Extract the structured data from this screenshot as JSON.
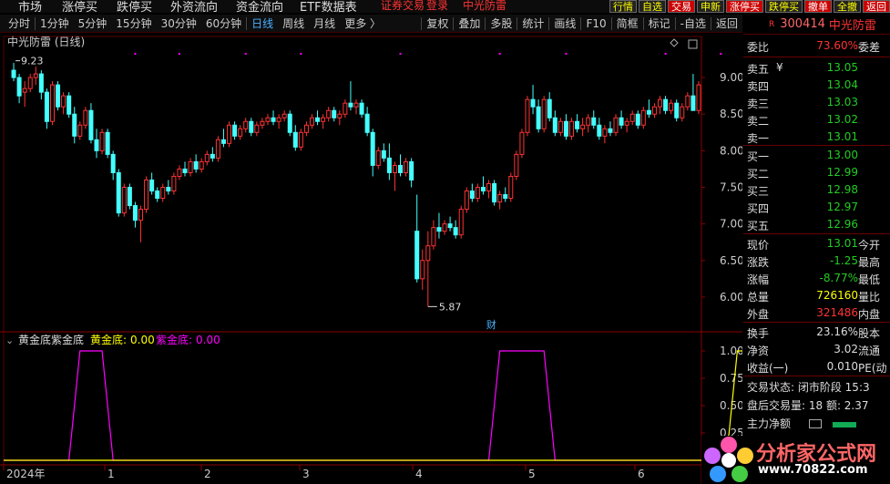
{
  "menu": {
    "items": [
      "市场",
      "涨停买",
      "跌停买",
      "外资流向",
      "资金流向",
      "ETF数据表"
    ],
    "center_left": "证券交易",
    "center_mid": "登录",
    "center_right": "中光防雷"
  },
  "quick_buttons": [
    "行情",
    "自选",
    "交易",
    "申新",
    "涨停买",
    "跌停买",
    "撤单",
    "全撤",
    "返回"
  ],
  "periods": [
    "分时",
    "1分钟",
    "5分钟",
    "15分钟",
    "30分钟",
    "60分钟",
    "日线",
    "周线",
    "月线",
    "更多 〉"
  ],
  "active_period": "日线",
  "tools": [
    "复权",
    "叠加",
    "多股",
    "统计",
    "画线",
    "F10",
    "简框",
    "标记",
    "-自选",
    "返回"
  ],
  "stock": {
    "r": "R",
    "code": "300414",
    "name": "中光防雷"
  },
  "chart_title": "中光防雷 (日线)",
  "indicator": {
    "name": "黄金底紫金底",
    "gold_label": "黄金底:",
    "gold_value": "0.00",
    "purple_label": "紫金底:",
    "purple_value": "0.00"
  },
  "annotations": {
    "high": "9.23",
    "low": "5.87",
    "fin": "财"
  },
  "x_labels": [
    "2024年",
    "1",
    "2",
    "3",
    "4",
    "5",
    "6"
  ],
  "panel": {
    "weibi": {
      "label": "委比",
      "value": "73.60%",
      "right": "委差"
    },
    "asks": [
      {
        "label": "卖五",
        "mark": "¥",
        "price": "13.05"
      },
      {
        "label": "卖四",
        "price": "13.04"
      },
      {
        "label": "卖三",
        "price": "13.03"
      },
      {
        "label": "卖二",
        "price": "13.02"
      },
      {
        "label": "卖一",
        "price": "13.01"
      }
    ],
    "bids": [
      {
        "label": "买一",
        "price": "13.00"
      },
      {
        "label": "买二",
        "price": "12.99"
      },
      {
        "label": "买三",
        "price": "12.98"
      },
      {
        "label": "买四",
        "price": "12.97"
      },
      {
        "label": "买五",
        "price": "12.96"
      }
    ],
    "stats": [
      {
        "label": "现价",
        "value": "13.01",
        "right": "今开",
        "color": "gr"
      },
      {
        "label": "涨跌",
        "value": "-1.25",
        "right": "最高",
        "color": "gr"
      },
      {
        "label": "涨幅",
        "value": "-8.77%",
        "right": "最低",
        "color": "gr"
      },
      {
        "label": "总量",
        "value": "726160",
        "right": "量比",
        "color": "yl"
      },
      {
        "label": "外盘",
        "value": "321486",
        "right": "内盘",
        "color": "rd"
      }
    ],
    "stats2": [
      {
        "label": "换手",
        "value": "23.16%",
        "right": "股本"
      },
      {
        "label": "净资",
        "value": "3.02",
        "right": "流通"
      },
      {
        "label": "收益(一)",
        "value": "0.010",
        "right": "PE(动"
      }
    ],
    "trade_status": "交易状态: 闭市阶段 15:3",
    "after_vol": "盘后交易量: 18  额: 2.37",
    "main_flow": "主力净额"
  },
  "logo": {
    "text": "分析家公式网",
    "url": "www.70822.com"
  },
  "chart_data": {
    "type": "candlestick",
    "title": "中光防雷 (日线)",
    "ylim": [
      5.7,
      9.35
    ],
    "y_ticks": [
      9.0,
      8.5,
      8.0,
      7.5,
      7.0,
      6.5,
      6.0
    ],
    "high_annotation": 9.23,
    "low_annotation": 5.87,
    "candles": [
      [
        9.1,
        9.2,
        8.95,
        9.0
      ],
      [
        9.0,
        9.05,
        8.65,
        8.75
      ],
      [
        8.8,
        8.95,
        8.6,
        8.85
      ],
      [
        8.85,
        9.05,
        8.8,
        9.0
      ],
      [
        9.0,
        9.15,
        8.9,
        9.05
      ],
      [
        9.05,
        9.1,
        8.7,
        8.8
      ],
      [
        8.8,
        8.85,
        8.3,
        8.4
      ],
      [
        8.4,
        8.95,
        8.35,
        8.9
      ],
      [
        8.9,
        8.95,
        8.55,
        8.6
      ],
      [
        8.6,
        8.8,
        8.5,
        8.75
      ],
      [
        8.75,
        8.8,
        8.45,
        8.5
      ],
      [
        8.5,
        8.6,
        8.1,
        8.2
      ],
      [
        8.2,
        8.4,
        8.15,
        8.35
      ],
      [
        8.35,
        8.6,
        8.3,
        8.55
      ],
      [
        8.55,
        8.65,
        8.1,
        8.15
      ],
      [
        8.15,
        8.3,
        7.9,
        8.0
      ],
      [
        8.0,
        8.3,
        7.95,
        8.25
      ],
      [
        8.25,
        8.3,
        7.9,
        7.95
      ],
      [
        7.95,
        8.0,
        7.6,
        7.7
      ],
      [
        7.7,
        7.75,
        7.1,
        7.15
      ],
      [
        7.15,
        7.55,
        7.1,
        7.5
      ],
      [
        7.5,
        7.55,
        7.2,
        7.25
      ],
      [
        7.25,
        7.3,
        6.95,
        7.05
      ],
      [
        7.05,
        7.25,
        6.75,
        7.2
      ],
      [
        7.2,
        7.65,
        7.15,
        7.6
      ],
      [
        7.6,
        7.7,
        7.4,
        7.45
      ],
      [
        7.45,
        7.5,
        7.3,
        7.35
      ],
      [
        7.35,
        7.55,
        7.3,
        7.5
      ],
      [
        7.5,
        7.6,
        7.4,
        7.45
      ],
      [
        7.45,
        7.7,
        7.4,
        7.65
      ],
      [
        7.65,
        7.8,
        7.6,
        7.75
      ],
      [
        7.75,
        7.85,
        7.65,
        7.7
      ],
      [
        7.7,
        7.9,
        7.65,
        7.85
      ],
      [
        7.85,
        7.95,
        7.7,
        7.75
      ],
      [
        7.75,
        7.9,
        7.7,
        7.85
      ],
      [
        7.85,
        8.0,
        7.8,
        7.95
      ],
      [
        7.95,
        8.05,
        7.85,
        7.9
      ],
      [
        7.9,
        8.2,
        7.85,
        8.15
      ],
      [
        8.15,
        8.3,
        8.05,
        8.1
      ],
      [
        8.1,
        8.4,
        8.05,
        8.35
      ],
      [
        8.35,
        8.4,
        8.15,
        8.2
      ],
      [
        8.2,
        8.35,
        8.15,
        8.3
      ],
      [
        8.3,
        8.45,
        8.25,
        8.4
      ],
      [
        8.4,
        8.45,
        8.2,
        8.25
      ],
      [
        8.25,
        8.4,
        8.2,
        8.35
      ],
      [
        8.35,
        8.45,
        8.3,
        8.4
      ],
      [
        8.4,
        8.5,
        8.35,
        8.45
      ],
      [
        8.45,
        8.55,
        8.35,
        8.4
      ],
      [
        8.4,
        8.5,
        8.3,
        8.45
      ],
      [
        8.45,
        8.55,
        8.4,
        8.5
      ],
      [
        8.5,
        8.55,
        8.2,
        8.25
      ],
      [
        8.25,
        8.35,
        8.0,
        8.05
      ],
      [
        8.05,
        8.3,
        8.0,
        8.25
      ],
      [
        8.25,
        8.4,
        8.2,
        8.35
      ],
      [
        8.35,
        8.5,
        8.3,
        8.45
      ],
      [
        8.45,
        8.55,
        8.35,
        8.4
      ],
      [
        8.4,
        8.5,
        8.3,
        8.45
      ],
      [
        8.45,
        8.6,
        8.4,
        8.55
      ],
      [
        8.55,
        8.6,
        8.4,
        8.45
      ],
      [
        8.45,
        8.55,
        8.35,
        8.5
      ],
      [
        8.5,
        8.7,
        8.45,
        8.65
      ],
      [
        8.65,
        8.95,
        8.55,
        8.6
      ],
      [
        8.6,
        8.7,
        8.5,
        8.65
      ],
      [
        8.65,
        8.7,
        8.45,
        8.5
      ],
      [
        8.5,
        8.6,
        8.2,
        8.25
      ],
      [
        8.25,
        8.3,
        7.65,
        7.8
      ],
      [
        7.8,
        8.05,
        7.75,
        8.0
      ],
      [
        8.0,
        8.1,
        7.85,
        7.9
      ],
      [
        7.9,
        8.1,
        7.6,
        7.7
      ],
      [
        7.7,
        7.85,
        7.45,
        7.8
      ],
      [
        7.8,
        7.95,
        7.65,
        7.7
      ],
      [
        7.7,
        7.9,
        7.65,
        7.85
      ],
      [
        7.85,
        7.9,
        7.5,
        7.6
      ],
      [
        6.9,
        7.4,
        6.2,
        6.25
      ],
      [
        6.25,
        6.65,
        6.1,
        6.5
      ],
      [
        6.5,
        6.9,
        5.87,
        6.7
      ],
      [
        6.7,
        7.05,
        6.65,
        6.95
      ],
      [
        6.95,
        7.15,
        6.8,
        6.9
      ],
      [
        6.9,
        7.05,
        6.85,
        7.0
      ],
      [
        7.0,
        7.1,
        6.9,
        6.95
      ],
      [
        6.95,
        7.05,
        6.8,
        6.85
      ],
      [
        6.85,
        7.25,
        6.8,
        7.2
      ],
      [
        7.2,
        7.5,
        7.15,
        7.45
      ],
      [
        7.45,
        7.55,
        7.3,
        7.35
      ],
      [
        7.35,
        7.55,
        7.3,
        7.5
      ],
      [
        7.5,
        7.65,
        7.4,
        7.45
      ],
      [
        7.45,
        7.6,
        7.35,
        7.55
      ],
      [
        7.55,
        7.6,
        7.25,
        7.3
      ],
      [
        7.3,
        7.45,
        7.2,
        7.4
      ],
      [
        7.4,
        7.5,
        7.3,
        7.35
      ],
      [
        7.35,
        7.7,
        7.3,
        7.65
      ],
      [
        7.65,
        8.0,
        7.6,
        7.95
      ],
      [
        7.95,
        8.3,
        7.9,
        8.25
      ],
      [
        8.25,
        8.75,
        8.2,
        8.7
      ],
      [
        8.7,
        8.9,
        8.5,
        8.6
      ],
      [
        8.6,
        8.7,
        8.25,
        8.3
      ],
      [
        8.3,
        8.75,
        8.25,
        8.7
      ],
      [
        8.7,
        8.8,
        8.4,
        8.45
      ],
      [
        8.45,
        8.55,
        8.2,
        8.25
      ],
      [
        8.25,
        8.45,
        8.2,
        8.4
      ],
      [
        8.4,
        8.5,
        8.15,
        8.2
      ],
      [
        8.2,
        8.45,
        8.15,
        8.4
      ],
      [
        8.4,
        8.5,
        8.25,
        8.3
      ],
      [
        8.3,
        8.45,
        8.2,
        8.35
      ],
      [
        8.35,
        8.5,
        8.25,
        8.45
      ],
      [
        8.45,
        8.55,
        8.3,
        8.35
      ],
      [
        8.35,
        8.45,
        8.15,
        8.2
      ],
      [
        8.2,
        8.35,
        8.1,
        8.3
      ],
      [
        8.3,
        8.4,
        8.2,
        8.25
      ],
      [
        8.25,
        8.5,
        8.2,
        8.45
      ],
      [
        8.45,
        8.55,
        8.3,
        8.35
      ],
      [
        8.35,
        8.45,
        8.25,
        8.4
      ],
      [
        8.4,
        8.55,
        8.35,
        8.5
      ],
      [
        8.5,
        8.55,
        8.3,
        8.35
      ],
      [
        8.35,
        8.6,
        8.3,
        8.55
      ],
      [
        8.55,
        8.7,
        8.45,
        8.5
      ],
      [
        8.5,
        8.65,
        8.45,
        8.6
      ],
      [
        8.6,
        8.75,
        8.5,
        8.7
      ],
      [
        8.7,
        8.75,
        8.5,
        8.55
      ],
      [
        8.55,
        8.7,
        8.5,
        8.65
      ],
      [
        8.65,
        8.7,
        8.4,
        8.45
      ],
      [
        8.45,
        8.65,
        8.4,
        8.6
      ],
      [
        8.6,
        8.8,
        8.55,
        8.75
      ],
      [
        8.75,
        9.05,
        8.7,
        8.55
      ],
      [
        8.55,
        8.95,
        8.5,
        8.9
      ]
    ],
    "indicator_gold": [
      [
        129,
        0
      ],
      [
        131,
        1
      ],
      [
        136,
        1
      ],
      [
        138,
        0
      ]
    ],
    "indicator_purple": [
      [
        10,
        0
      ],
      [
        12,
        1
      ],
      [
        16,
        1
      ],
      [
        18,
        0
      ],
      [
        86,
        0
      ],
      [
        88,
        1
      ],
      [
        96,
        1
      ],
      [
        98,
        0
      ]
    ],
    "ind_ticks": [
      1.0,
      0.75,
      0.5,
      0.25
    ],
    "markers_x": [
      22,
      30,
      42,
      52,
      70,
      88,
      100,
      118,
      128,
      134,
      144,
      152
    ]
  }
}
